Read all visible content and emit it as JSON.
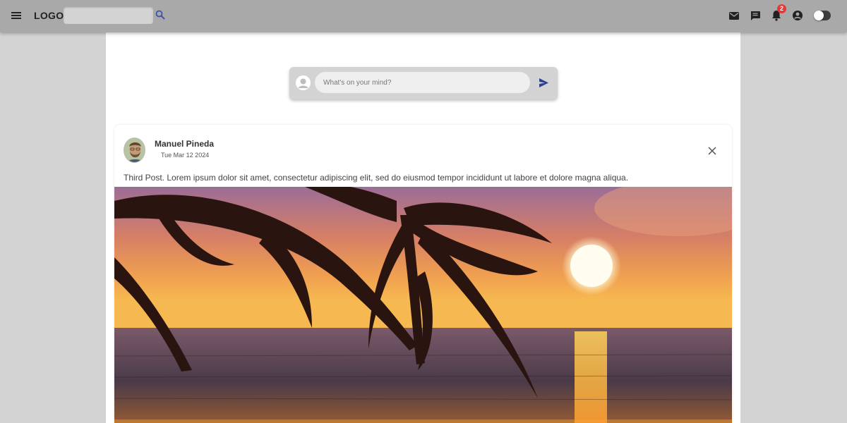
{
  "appbar": {
    "menu_icon": "menu-icon",
    "logo": "LOGO",
    "search": {
      "value": "",
      "placeholder": ""
    },
    "search_icon": "search-icon",
    "icons": [
      "mail-icon",
      "chat-icon",
      "notifications-icon",
      "account-icon"
    ],
    "notification_count": "2",
    "dark_mode_toggle": {
      "on": false
    }
  },
  "composer": {
    "avatar_icon": "user-avatar-icon",
    "placeholder": "What's on your mind?",
    "send_icon": "send-icon"
  },
  "post": {
    "author": "Manuel Pineda",
    "date": "Tue Mar 12 2024",
    "text": "Third Post. Lorem ipsum dolor sit amet, consectetur adipiscing elit, sed do eiusmod tempor incididunt ut labore et dolore magna aliqua.",
    "close_icon": "close-icon",
    "image": "sunset-palm-beach-photo"
  },
  "colors": {
    "appbar": "#a9a9a9",
    "page_bg": "#d3d3d3",
    "accent": "#3f51b5",
    "badge": "#e53935"
  }
}
